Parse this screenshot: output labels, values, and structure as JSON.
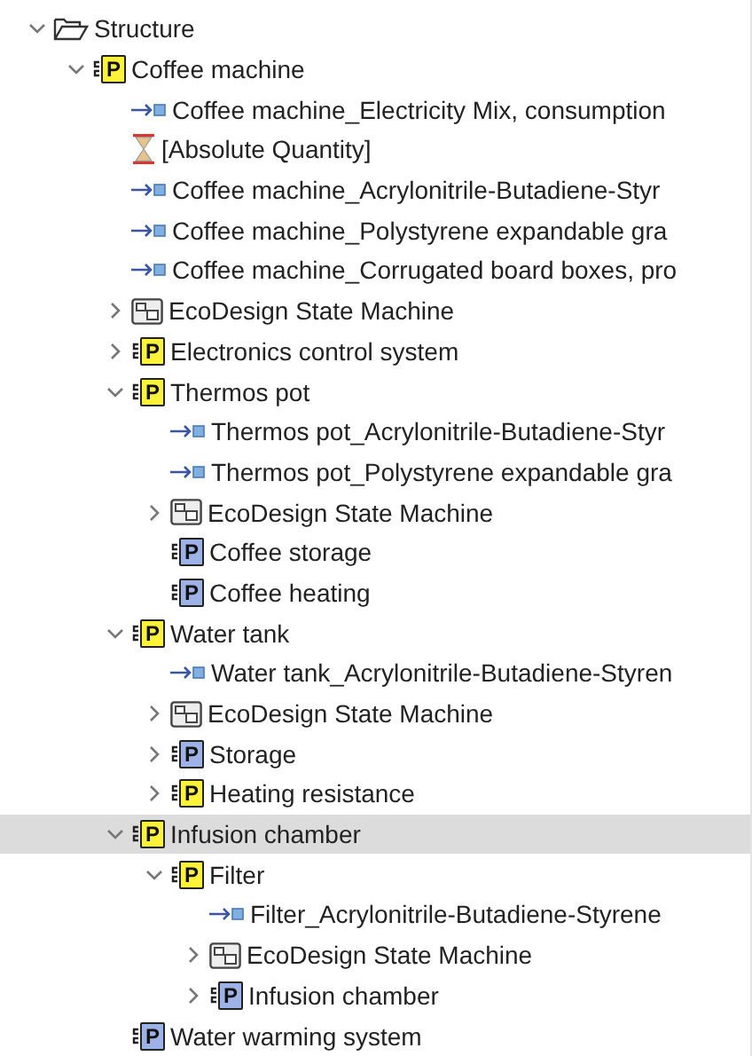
{
  "tree": [
    {
      "kind": "folder",
      "label": "Structure",
      "expanded": true,
      "selected": false,
      "children": [
        {
          "kind": "part",
          "badge": "P",
          "label": "Coffee machine",
          "expanded": true,
          "selected": false,
          "children": [
            {
              "kind": "flow",
              "label": "Coffee machine_Electricity Mix, consumption",
              "selected": false
            },
            {
              "kind": "quantity",
              "label": "[Absolute Quantity]",
              "selected": false
            },
            {
              "kind": "flow",
              "label": "Coffee machine_Acrylonitrile-Butadiene-Styr",
              "selected": false
            },
            {
              "kind": "flow",
              "label": "Coffee machine_Polystyrene expandable gra",
              "selected": false
            },
            {
              "kind": "flow",
              "label": "Coffee machine_Corrugated board boxes, pro",
              "selected": false
            },
            {
              "kind": "statemachine",
              "label": "EcoDesign State Machine",
              "expanded": false,
              "selected": false
            },
            {
              "kind": "part",
              "badge": "P",
              "label": "Electronics control system",
              "expanded": false,
              "selected": false
            },
            {
              "kind": "part",
              "badge": "P",
              "label": "Thermos pot",
              "expanded": true,
              "selected": false,
              "children": [
                {
                  "kind": "flow",
                  "label": "Thermos pot_Acrylonitrile-Butadiene-Styr",
                  "selected": false
                },
                {
                  "kind": "flow",
                  "label": "Thermos pot_Polystyrene expandable gra",
                  "selected": false
                },
                {
                  "kind": "statemachine",
                  "label": "EcoDesign State Machine",
                  "expanded": false,
                  "selected": false
                },
                {
                  "kind": "partref",
                  "badge": "P",
                  "label": "Coffee storage",
                  "selected": false
                },
                {
                  "kind": "partref",
                  "badge": "P",
                  "label": "Coffee heating",
                  "selected": false
                }
              ]
            },
            {
              "kind": "part",
              "badge": "P",
              "label": "Water tank",
              "expanded": true,
              "selected": false,
              "children": [
                {
                  "kind": "flow",
                  "label": "Water tank_Acrylonitrile-Butadiene-Styren",
                  "selected": false
                },
                {
                  "kind": "statemachine",
                  "label": "EcoDesign State Machine",
                  "expanded": false,
                  "selected": false
                },
                {
                  "kind": "partref",
                  "badge": "P",
                  "label": "Storage",
                  "expanded": false,
                  "selected": false
                },
                {
                  "kind": "part",
                  "badge": "P",
                  "label": "Heating resistance",
                  "expanded": false,
                  "selected": false
                }
              ]
            },
            {
              "kind": "part",
              "badge": "P",
              "label": "Infusion chamber",
              "expanded": true,
              "selected": true,
              "children": [
                {
                  "kind": "part",
                  "badge": "P",
                  "label": "Filter",
                  "expanded": true,
                  "selected": false,
                  "children": [
                    {
                      "kind": "flow",
                      "label": "Filter_Acrylonitrile-Butadiene-Styrene",
                      "selected": false
                    },
                    {
                      "kind": "statemachine",
                      "label": "EcoDesign State Machine",
                      "expanded": false,
                      "selected": false
                    },
                    {
                      "kind": "partref",
                      "badge": "P",
                      "label": "Infusion chamber",
                      "expanded": false,
                      "selected": false
                    }
                  ]
                }
              ]
            },
            {
              "kind": "partref",
              "badge": "P",
              "label": "Water warming system",
              "selected": false
            }
          ]
        }
      ]
    }
  ]
}
